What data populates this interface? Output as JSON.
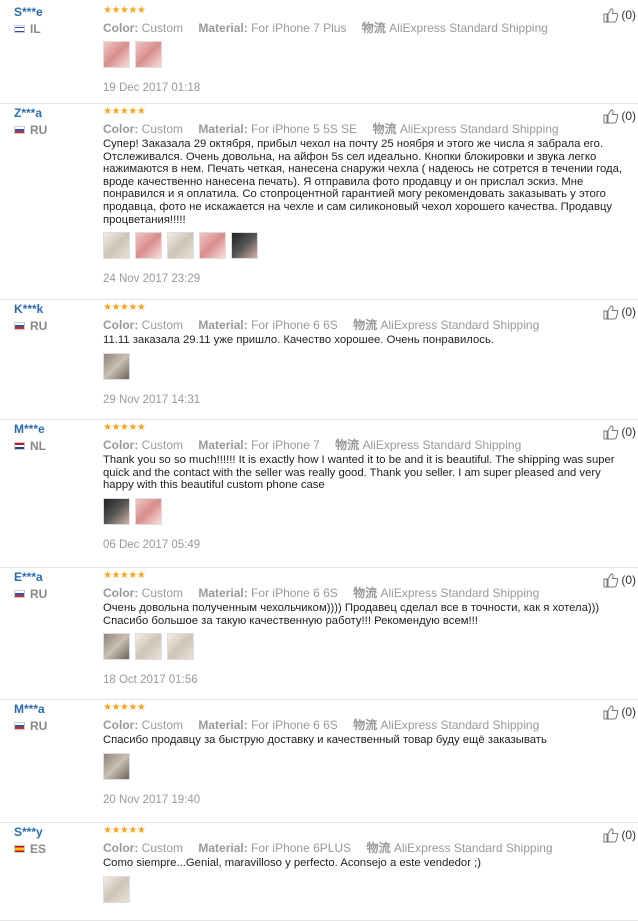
{
  "labels": {
    "color": "Color:",
    "material": "Material:",
    "shipping": "物流"
  },
  "reviews": [
    {
      "user": "S***e",
      "country": "IL",
      "stars": "★★★★★",
      "color": "Custom",
      "material": "For iPhone 7 Plus",
      "shipping": "AliExpress Standard Shipping",
      "helpful": "(0)",
      "feedback": "",
      "photos": [
        "pink",
        "pink"
      ],
      "date": "19 Dec 2017 01:18"
    },
    {
      "user": "Z***a",
      "country": "RU",
      "stars": "★★★★★",
      "color": "Custom",
      "material": "For iPhone 5 5S SE",
      "shipping": "AliExpress Standard Shipping",
      "helpful": "(0)",
      "feedback": "Супер! Заказала 29 октября, прибыл чехол на почту 25 ноября и этого же числа я забрала его. Отслеживался. Очень довольна, на айфон 5s сел идеально. Кнопки блокировки и звука легко нажимаются в нем. Печать четкая, нанесена снаружи чехла ( надеюсь не сотрется в течении года, вроде качественно нанесена печать). Я отправила фото продавцу и он прислал эскиз. Мне понравился и я оплатила. Со стопроцентной гарантией могу рекомендовать заказывать у этого продавца, фото не искажается на чехле и сам силиконовый чехол хорошего качества. Продавцу процветания!!!!!",
      "photos": [
        "light",
        "pink",
        "light",
        "pink",
        "dark"
      ],
      "date": "24 Nov 2017 23:29"
    },
    {
      "user": "K***k",
      "country": "RU",
      "stars": "★★★★★",
      "color": "Custom",
      "material": "For iPhone 6 6S",
      "shipping": "AliExpress Standard Shipping",
      "helpful": "(0)",
      "feedback": "11.11 заказала 29.11 уже пришло. Качество хорошее. Очень понравилось.",
      "photos": [
        "grey"
      ],
      "date": "29 Nov 2017 14:31"
    },
    {
      "user": "M***e",
      "country": "NL",
      "stars": "★★★★★",
      "color": "Custom",
      "material": "For iPhone 7",
      "shipping": "AliExpress Standard Shipping",
      "helpful": "(0)",
      "feedback": "Thank you so so much!!!!!! It is exactly how I wanted it to be and it is beautiful. The shipping was super quick and the contact with the seller was really good. Thank you seller. I am super pleased and very happy with this beautiful custom phone case",
      "photos": [
        "dark",
        "pink"
      ],
      "date": "06 Dec 2017 05:49"
    },
    {
      "user": "E***a",
      "country": "RU",
      "stars": "★★★★★",
      "color": "Custom",
      "material": "For iPhone 6 6S",
      "shipping": "AliExpress Standard Shipping",
      "helpful": "(0)",
      "feedback": "Очень довольна полученным чехольчиком)))) Продавец сделал все в точности, как я хотела))) Спасибо большое за такую качественную работу!!! Рекомендую всем!!!",
      "photos": [
        "grey",
        "light",
        "light"
      ],
      "date": "18 Oct 2017 01:56"
    },
    {
      "user": "M***a",
      "country": "RU",
      "stars": "★★★★★",
      "color": "Custom",
      "material": "For iPhone 6 6S",
      "shipping": "AliExpress Standard Shipping",
      "helpful": "(0)",
      "feedback": "Спасибо продавцу за быструю доставку и качественный товар буду ещё заказывать",
      "photos": [
        "grey"
      ],
      "date": "20 Nov 2017 19:40"
    },
    {
      "user": "S***y",
      "country": "ES",
      "stars": "★★★★★",
      "color": "Custom",
      "material": "For iPhone 6PLUS",
      "shipping": "AliExpress Standard Shipping",
      "helpful": "(0)",
      "feedback": "Como siempre...Genial, maravilloso y perfecto. Aconsejo a este vendedor ;)",
      "photos": [
        "light"
      ],
      "date": ""
    }
  ]
}
